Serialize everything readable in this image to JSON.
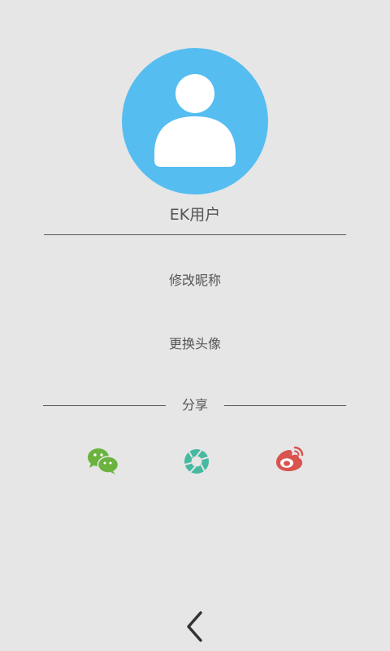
{
  "profile": {
    "username": "EK用户"
  },
  "menu": {
    "rename_label": "修改昵称",
    "change_avatar_label": "更换头像"
  },
  "share": {
    "label": "分享",
    "targets": [
      "wechat-icon",
      "moments-icon",
      "weibo-icon"
    ]
  },
  "navigation": {
    "back_icon": "chevron-left-icon"
  },
  "colors": {
    "background": "#e6e6e6",
    "avatar": "#55bdf0",
    "text": "#555555",
    "wechat": "#6ab33f",
    "moments": "#47b9a0",
    "weibo": "#d9534f"
  }
}
